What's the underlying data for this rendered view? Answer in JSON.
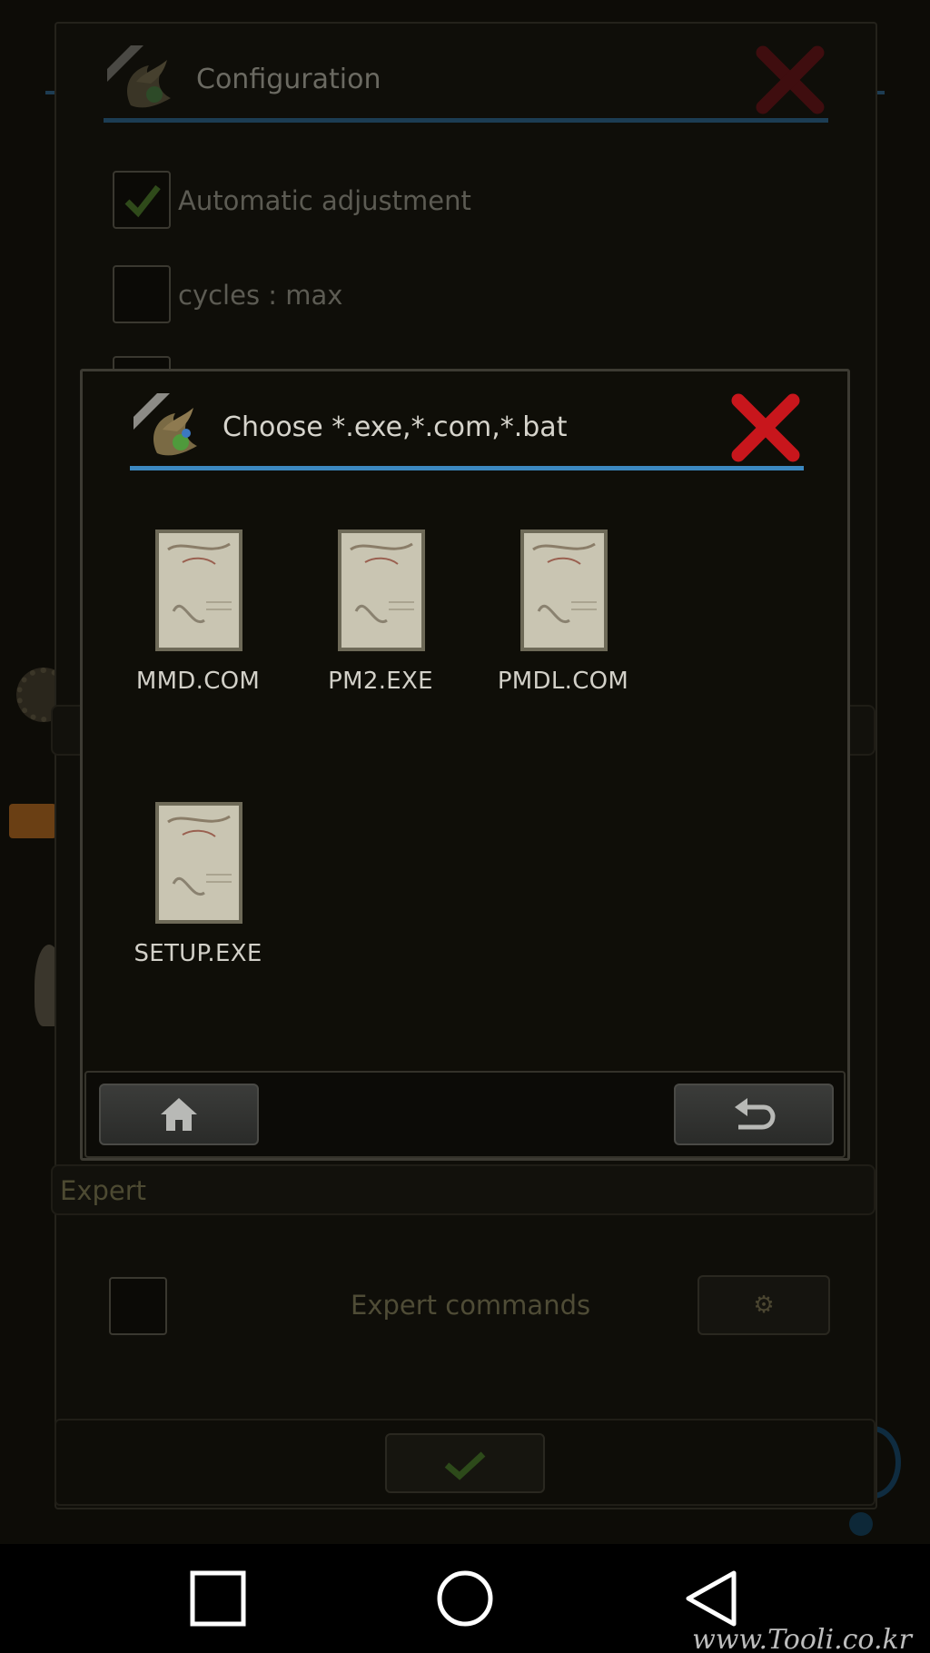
{
  "config_dialog": {
    "title": "Configuration",
    "options": [
      {
        "label": "Automatic adjustment",
        "checked": true
      },
      {
        "label": "cycles : max",
        "checked": false
      }
    ],
    "expert_section": {
      "header": "Expert",
      "option_label": "Expert commands",
      "checked": false
    }
  },
  "file_chooser": {
    "title": "Choose *.exe,*.com,*.bat",
    "files": [
      {
        "name": "MMD.COM"
      },
      {
        "name": "PM2.EXE"
      },
      {
        "name": "PMDL.COM"
      },
      {
        "name": "SETUP.EXE"
      }
    ],
    "home_icon": "home-icon",
    "back_icon": "back-arrow-icon"
  },
  "watermark": "www.Tooli.co.kr",
  "colors": {
    "accent_blue": "#3c88c0",
    "close_red": "#c8161c",
    "check_green": "#5aa02c"
  }
}
